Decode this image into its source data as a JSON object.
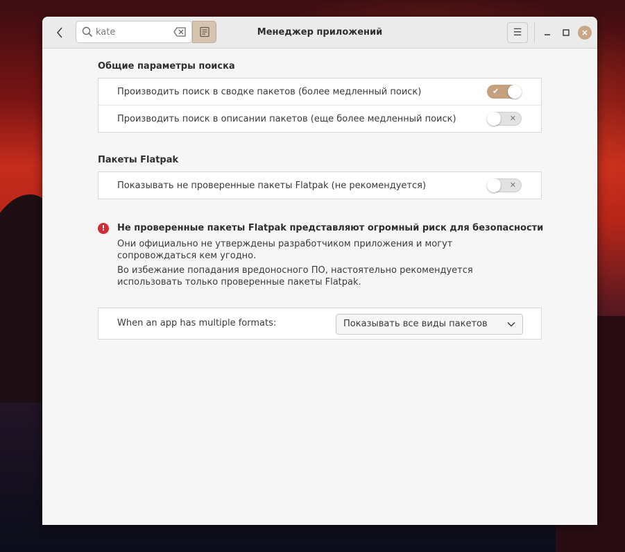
{
  "header": {
    "title": "Менеджер приложений",
    "back_icon": "chevron-left-icon",
    "search": {
      "value": "kate",
      "placeholder": ""
    },
    "menu_icon": "☰",
    "window_controls": {
      "minimize_icon": "minimize-icon",
      "maximize_icon": "maximize-icon",
      "close_icon": "×"
    }
  },
  "general_search": {
    "title": "Общие параметры поиска",
    "options": [
      {
        "label": "Производить поиск в сводке пакетов (более медленный поиск)",
        "enabled": true
      },
      {
        "label": "Производить поиск в описании пакетов (еще более медленный поиск)",
        "enabled": false
      }
    ]
  },
  "flatpak": {
    "title": "Пакеты Flatpak",
    "options": [
      {
        "label": "Показывать не проверенные пакеты Flatpak (не рекомендуется)",
        "enabled": false
      }
    ],
    "warning": {
      "icon": "!",
      "title": "Не проверенные пакеты Flatpak представляют огромный риск для безопасности",
      "text1": "Они официально не утверждены разработчиком приложения и могут сопровождаться кем угодно.",
      "text2": "Во избежание попадания вредоносного ПО, настоятельно рекомендуется использовать только проверенные пакеты Flatpak."
    }
  },
  "formats": {
    "label": "When an app has multiple formats:",
    "selected": "Показывать все виды пакетов"
  },
  "toggle_marks": {
    "on": "✔",
    "off": "✕"
  },
  "colors": {
    "accent": "#c3a07e",
    "close_button": "#c9a787",
    "warning": "#d12d38"
  }
}
